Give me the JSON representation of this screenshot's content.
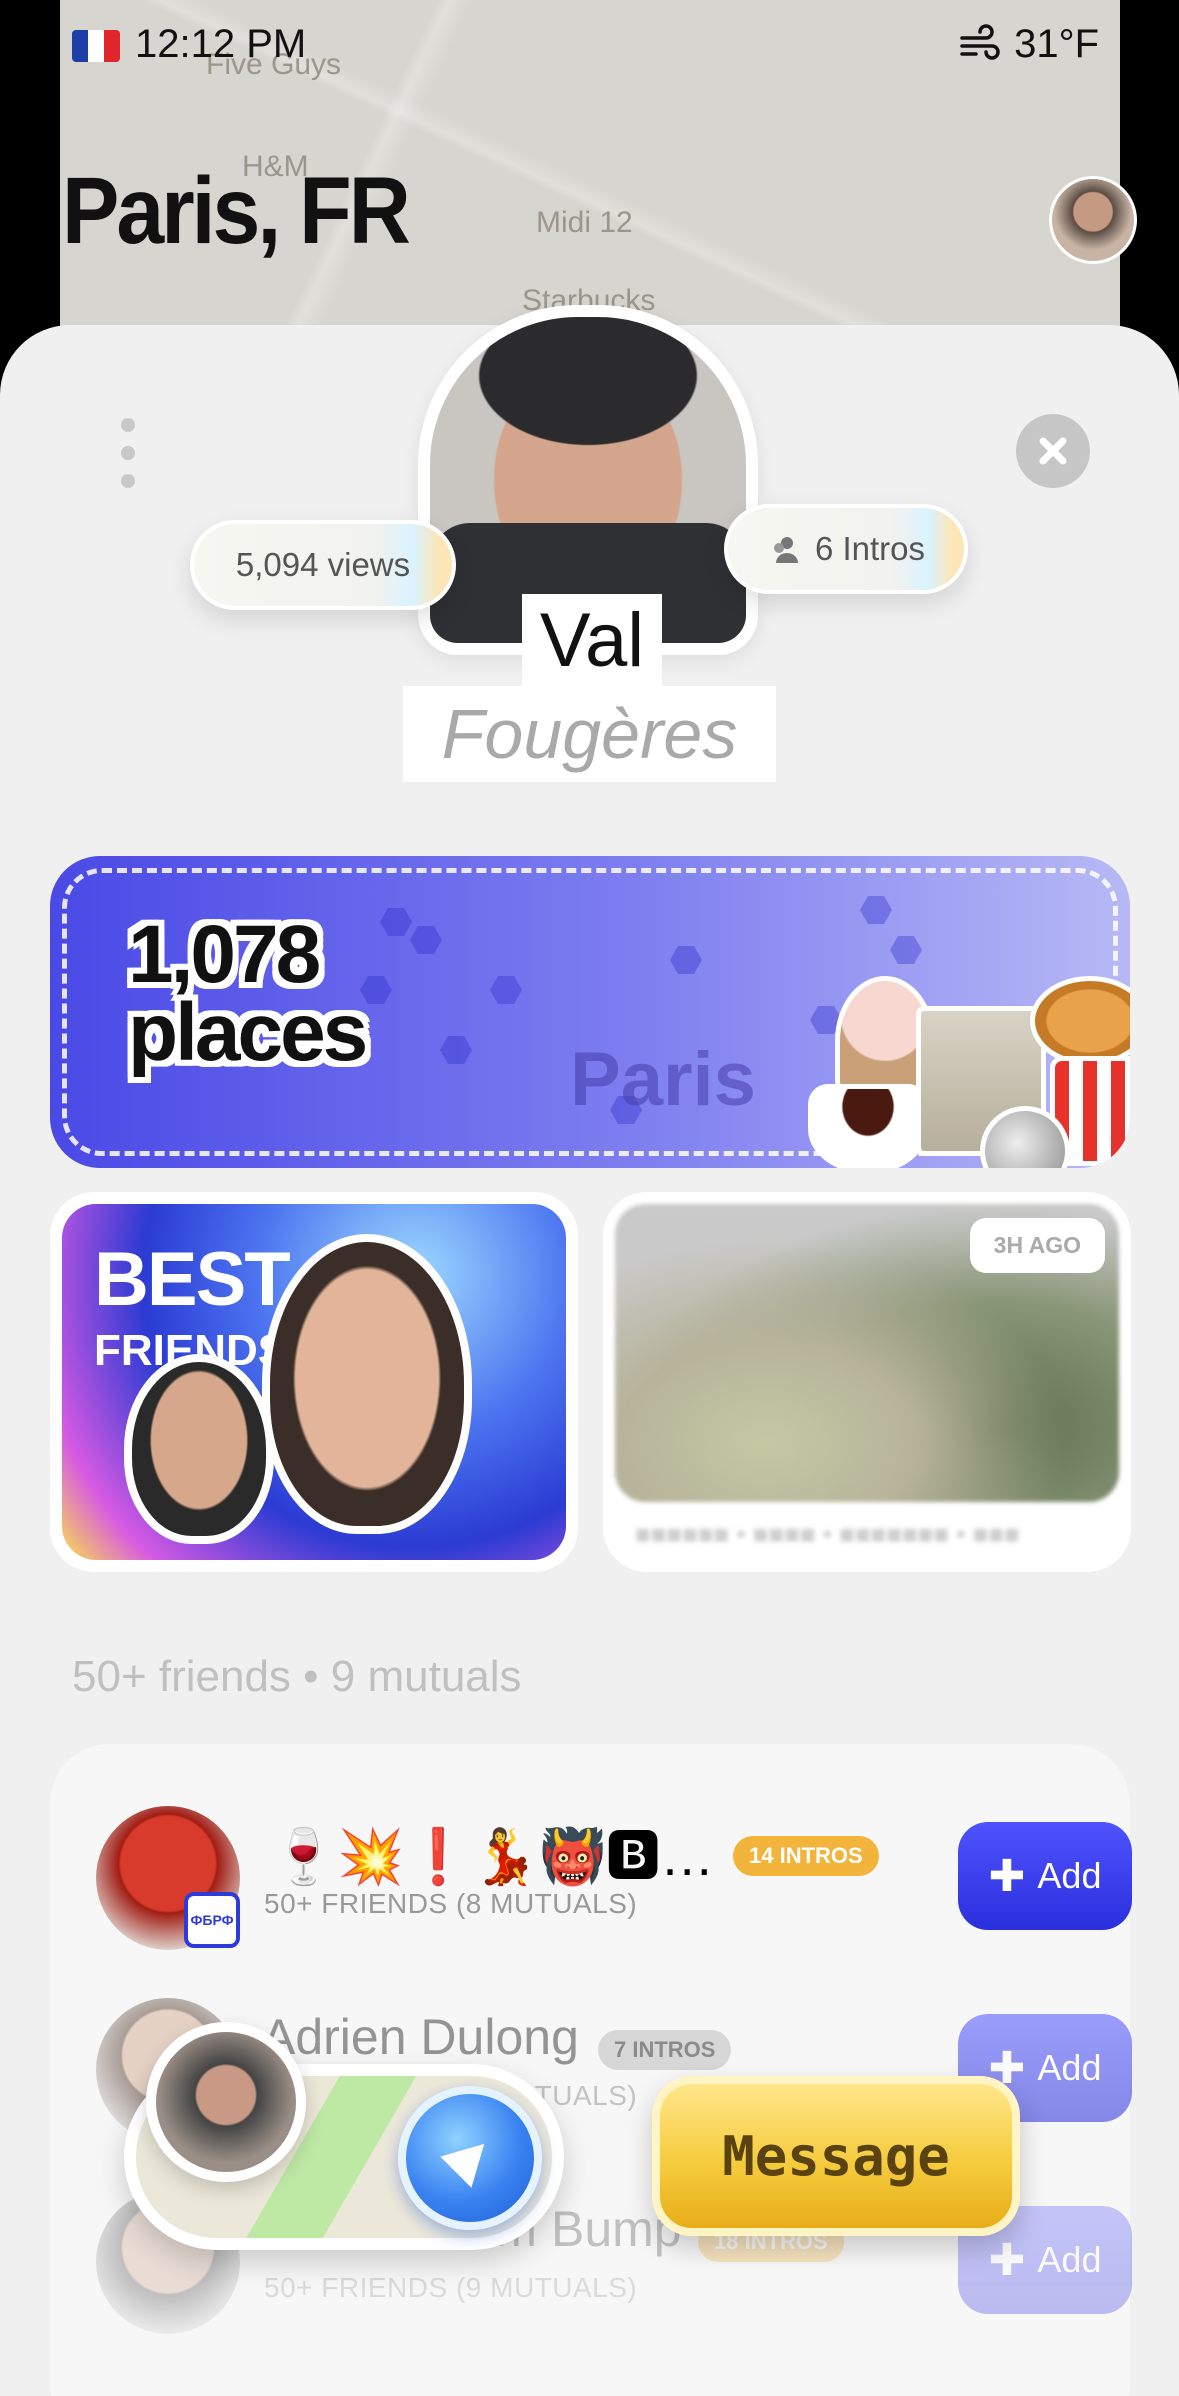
{
  "status_bar": {
    "time": "12:12 PM",
    "temperature": "31°F",
    "weather_icon": "wind-icon"
  },
  "background": {
    "city_title": "Paris, FR",
    "map_labels": [
      "Five Guys",
      "H&M",
      "Midi 12",
      "Starbucks"
    ]
  },
  "profile": {
    "first_name": "Val",
    "last_name": "Fougères",
    "views": "5,094 views",
    "intros": "6 Intros"
  },
  "places": {
    "count": "1,078",
    "label": "places",
    "city": "Paris"
  },
  "tiles": {
    "best_friends_title": "BEST",
    "best_friends_sub": "FRIENDS",
    "time_ago": "3H AGO"
  },
  "friends": {
    "heading": "50+ friends • 9 mutuals",
    "list": [
      {
        "name_emojis": "🍷💥❗💃👹🅱…",
        "badge": "14 INTROS",
        "subtitle": "50+ FRIENDS (8 MUTUALS)",
        "avatar_tag": "ФБРФ",
        "button": "Add"
      },
      {
        "name": "Adrien Dulong",
        "badge": "7 INTROS",
        "subtitle": "50+ FRIENDS (? MUTUALS)",
        "button": "Add"
      },
      {
        "name": "Adrien From Bump",
        "badge": "18 INTROS",
        "subtitle": "50+ FRIENDS (9 MUTUALS)",
        "button": "Add"
      }
    ]
  },
  "actions": {
    "message": "Message"
  },
  "colors": {
    "accent_blue": "#3a3ee6",
    "gold": "#f2b43a",
    "sheet_bg": "#f0f0f0"
  }
}
